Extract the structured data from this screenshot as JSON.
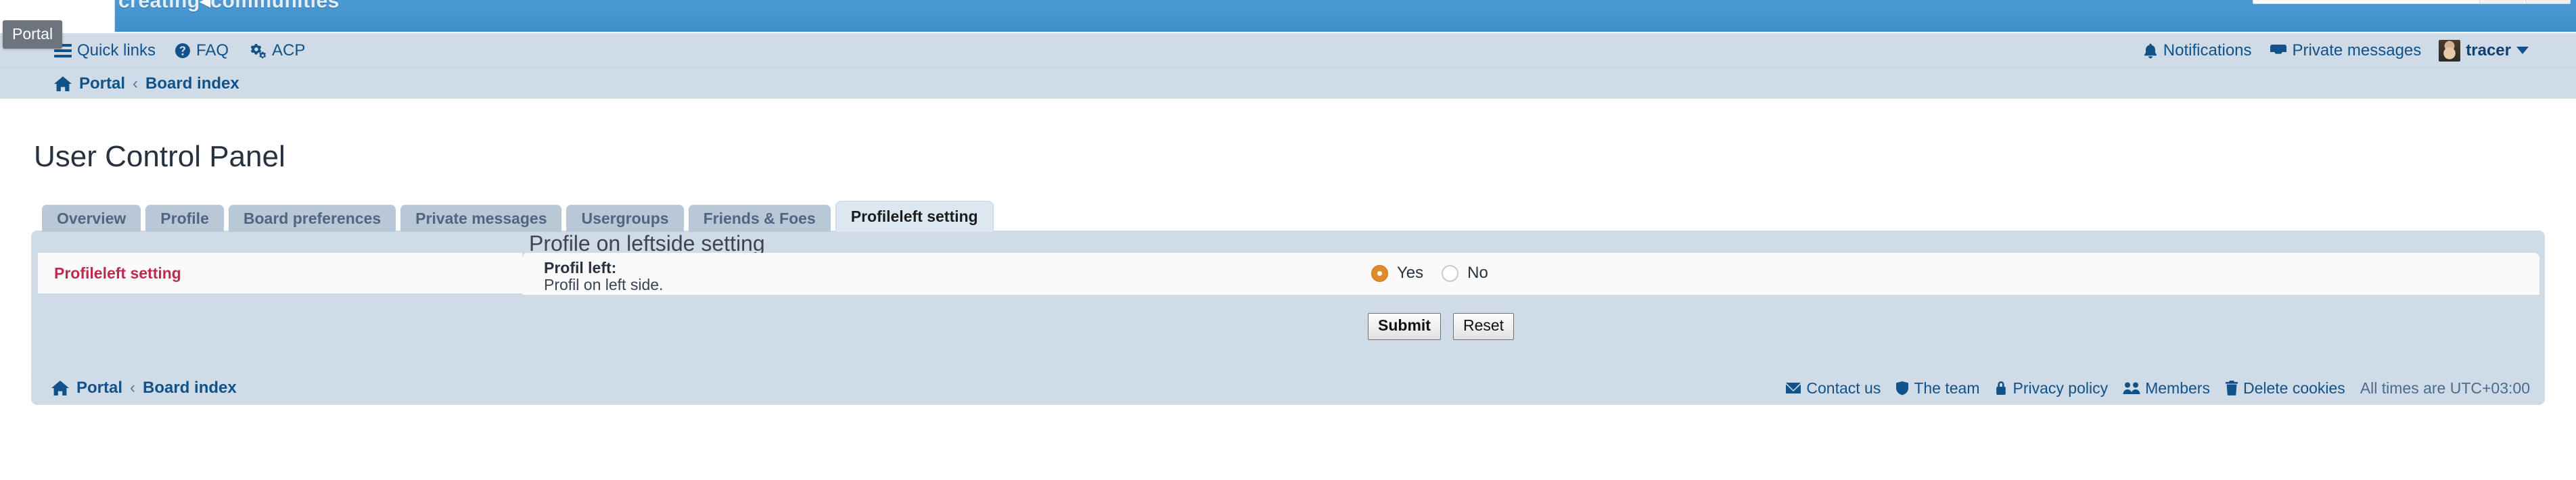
{
  "banner": {
    "site_name_part1": "creating",
    "site_name_part2": "communities"
  },
  "tooltip": {
    "text": "Portal"
  },
  "navbar": {
    "left_items": [
      {
        "label": "Quick links",
        "icon": "hamburger-menu-icon"
      },
      {
        "label": "FAQ",
        "icon": "question-circle-icon"
      },
      {
        "label": "ACP",
        "icon": "gears-icon"
      }
    ],
    "right_items": [
      {
        "label": "Notifications",
        "icon": "bell-icon"
      },
      {
        "label": "Private messages",
        "icon": "inbox-icon"
      }
    ],
    "username": "tracer",
    "avatar_name": "avatar"
  },
  "breadcrumb": {
    "home_icon": "home-icon",
    "items": [
      "Portal",
      "Board index"
    ],
    "separator": "‹"
  },
  "page": {
    "title": "User Control Panel"
  },
  "tabs": [
    {
      "label": "Overview",
      "active": false
    },
    {
      "label": "Profile",
      "active": false
    },
    {
      "label": "Board preferences",
      "active": false
    },
    {
      "label": "Private messages",
      "active": false
    },
    {
      "label": "Usergroups",
      "active": false
    },
    {
      "label": "Friends & Foes",
      "active": false
    },
    {
      "label": "Profileleft setting",
      "active": true
    }
  ],
  "sidebar": {
    "items": [
      {
        "label": "Profileleft setting",
        "active": true
      }
    ]
  },
  "main": {
    "panel_title": "Profile on leftside setting",
    "field": {
      "label": "Profil left:",
      "description": "Profil on left side.",
      "options": [
        {
          "label": "Yes",
          "selected": true
        },
        {
          "label": "No",
          "selected": false
        }
      ]
    },
    "buttons": {
      "submit": "Submit",
      "reset": "Reset"
    }
  },
  "footer": {
    "breadcrumb_items": [
      "Portal",
      "Board index"
    ],
    "separator": "‹",
    "links": [
      {
        "label": "Contact us",
        "icon": "envelope-icon"
      },
      {
        "label": "The team",
        "icon": "shield-icon"
      },
      {
        "label": "Privacy policy",
        "icon": "lock-icon"
      },
      {
        "label": "Members",
        "icon": "users-icon"
      },
      {
        "label": "Delete cookies",
        "icon": "trash-icon"
      }
    ],
    "timezone": "All times are UTC+03:00"
  },
  "colors": {
    "banner_blue": "#3f8fcc",
    "nav_background": "#cfdbe6",
    "link_blue": "#105289",
    "accent_red": "#bc2a4d",
    "radio_selected": "#e08a2e",
    "tab_active_bg": "#dce7f2"
  }
}
